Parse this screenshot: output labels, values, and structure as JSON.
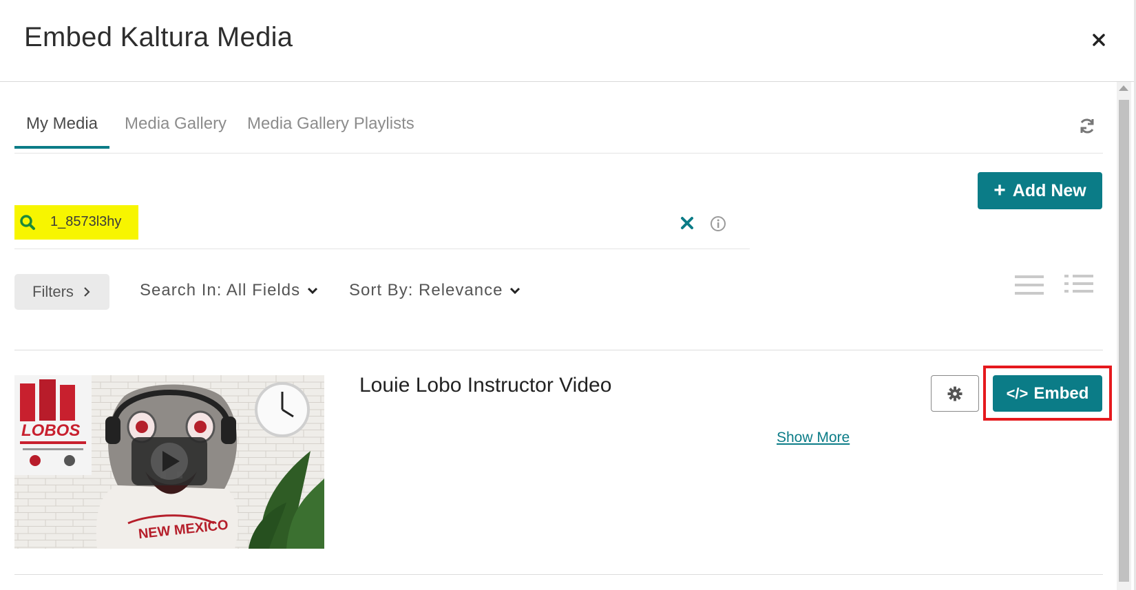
{
  "modal": {
    "title": "Embed Kaltura Media"
  },
  "tabs": [
    {
      "label": "My Media",
      "active": true
    },
    {
      "label": "Media Gallery",
      "active": false
    },
    {
      "label": "Media Gallery Playlists",
      "active": false
    }
  ],
  "toolbar": {
    "add_new_label": "Add New"
  },
  "search": {
    "value": "1_8573l3hy"
  },
  "filters": {
    "filters_label": "Filters",
    "search_in_label": "Search In: All Fields",
    "sort_by_label": "Sort By: Relevance"
  },
  "media_item": {
    "title": "Louie Lobo Instructor Video",
    "show_more_label": "Show More",
    "embed_label": "Embed",
    "thumbnail_poster_text": "LOBOS",
    "thumbnail_jersey_text": "NEW MEXICO"
  },
  "colors": {
    "accent": "#0b7c87",
    "highlight": "#f7f500",
    "callout": "#e5191d"
  },
  "icons": [
    "close-icon",
    "refresh-icon",
    "plus-icon",
    "search-icon",
    "clear-icon",
    "info-icon",
    "chevron-right-icon",
    "chevron-down-icon",
    "list-view-icon",
    "detailed-list-view-icon",
    "gear-icon",
    "code-icon",
    "play-icon"
  ]
}
